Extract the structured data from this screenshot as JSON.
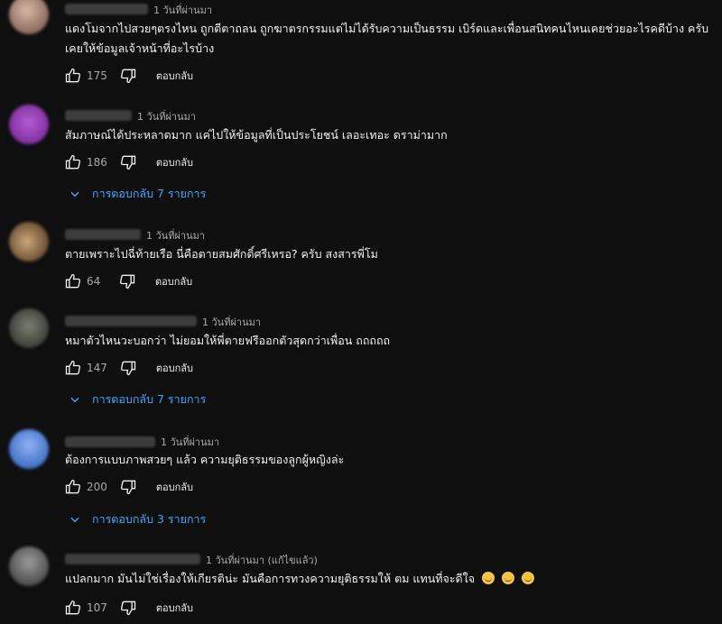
{
  "comments": [
    {
      "time": "1 วันที่ผ่านมา",
      "text": "แดงโมจากไปสวยๆตรงไหน ถูกตีตาถลน ถูกฆาตรกรรมแต่ไม่ได้รับความเป็นธรรม เบิร์ดและเพื่อนสนิทคนไหนเคยช่วยอะไรคดีบ้าง ครับ เคยให้ข้อมูลเจ้าหน้าที่อะไรบ้าง",
      "likes": "175",
      "reply_label": "ตอบกลับ"
    },
    {
      "time": "1 วันที่ผ่านมา",
      "text": "สัมภาษณ์ได้ประหลาดมาก แค่ไปให้ข้อมูลที่เป็นประโยชน์ เลอะเทอะ ดราม่ามาก",
      "likes": "186",
      "reply_label": "ตอบกลับ",
      "replies_label": "การตอบกลับ 7 รายการ"
    },
    {
      "time": "1 วันที่ผ่านมา",
      "text": "ตายเพราะไปฉี่ท้ายเรือ   นี่คือตายสมศักดิ์ศรีเหรอ? ครับ  สงสารพี่โม",
      "likes": "64",
      "reply_label": "ตอบกลับ"
    },
    {
      "time": "1 วันที่ผ่านมา",
      "text": "หมาตัวไหนวะบอกว่า ไม่ยอมให้พี่ตายฟรีออกตัวสุดกว่าเพื่อน ถถถถถ",
      "likes": "147",
      "reply_label": "ตอบกลับ",
      "replies_label": "การตอบกลับ 7 รายการ"
    },
    {
      "time": "1 วันที่ผ่านมา",
      "text": "ต้องการแบบภาพสวยๆ แล้ว ความยุติธรรมของลูกผู้หญิงล่ะ",
      "likes": "200",
      "reply_label": "ตอบกลับ",
      "replies_label": "การตอบกลับ 3 รายการ"
    },
    {
      "time": "1 วันที่ผ่านมา (แก้ไขแล้ว)",
      "text": "แปลกมาก มันไม่ใช่เรื่องให้เกียรติน่ะ มันคือการทวงความยุติธรรมให้ ตม แทนที่จะดีใจ",
      "likes": "107",
      "reply_label": "ตอบกลับ"
    }
  ],
  "icons": {
    "like": "thumb-up-icon",
    "dislike": "thumb-down-icon",
    "expand": "chevron-down-icon",
    "emoji": "grinning-sweat-emoji"
  },
  "colors": {
    "background": "#0f0f0f",
    "text": "#f1f1f1",
    "secondary": "#aaaaaa",
    "link": "#3ea6ff"
  }
}
